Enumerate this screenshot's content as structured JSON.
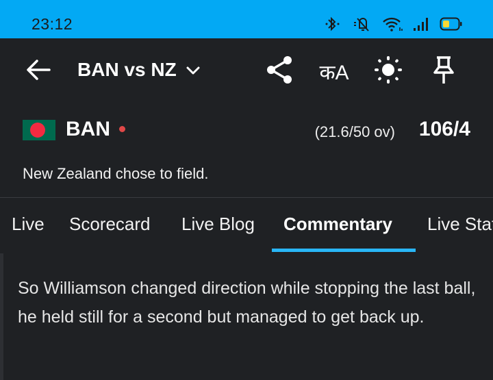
{
  "status_bar": {
    "time": "23:12",
    "icons": [
      "bluetooth-icon",
      "mute-icon",
      "wifi-icon",
      "signal-icon",
      "battery-icon"
    ],
    "color": "#03a9f4"
  },
  "app_bar": {
    "title": "BAN vs NZ",
    "lang_label": "कA",
    "icons": [
      "back-arrow-icon",
      "chevron-down-icon",
      "share-icon",
      "brightness-icon",
      "pin-icon"
    ]
  },
  "innings": {
    "team": "BAN",
    "overs": "(21.6/50 ov)",
    "score": "106/4",
    "toss": "New Zealand chose to field."
  },
  "tabs": [
    {
      "label": "Live"
    },
    {
      "label": "Scorecard"
    },
    {
      "label": "Live Blog"
    },
    {
      "label": "Commentary",
      "active": true
    },
    {
      "label": "Live Stats"
    }
  ],
  "commentary": {
    "text": "So Williamson changed direction while stopping the last ball, he held still for a second but managed to get back up."
  },
  "colors": {
    "background": "#1f2124",
    "accent": "#29b6f6",
    "live_dot": "#e04848"
  }
}
